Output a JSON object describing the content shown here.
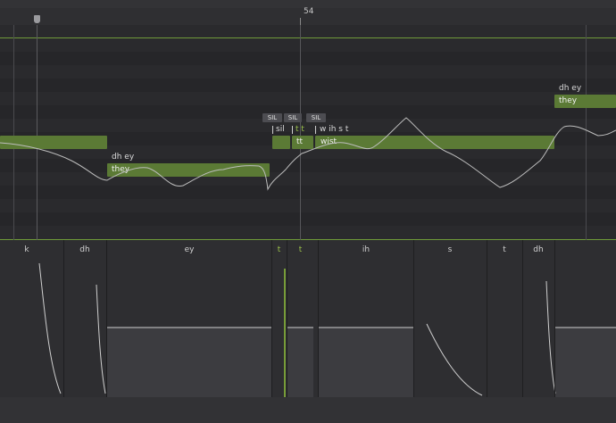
{
  "ruler": {
    "measure": "54"
  },
  "notes": [
    {
      "lyric": "",
      "phonemes": ""
    },
    {
      "lyric": "they",
      "phonemes": "dh ey"
    },
    {
      "lyric": "",
      "phonemes": "sil"
    },
    {
      "lyric": "tt",
      "phonemes": "t t"
    },
    {
      "lyric": "wist",
      "phonemes": "w ih s t"
    },
    {
      "lyric": "they",
      "phonemes": "dh ey"
    }
  ],
  "sil_badges": [
    "SIL",
    "SIL",
    "SIL"
  ],
  "phonemes": [
    "k",
    "dh",
    "ey",
    "t",
    "t",
    "ih",
    "s",
    "t",
    "dh"
  ],
  "colors": {
    "note_fill": "#5b7a35",
    "accent_line": "#7cae3a",
    "highlight_phoneme": "#9ac04a"
  }
}
